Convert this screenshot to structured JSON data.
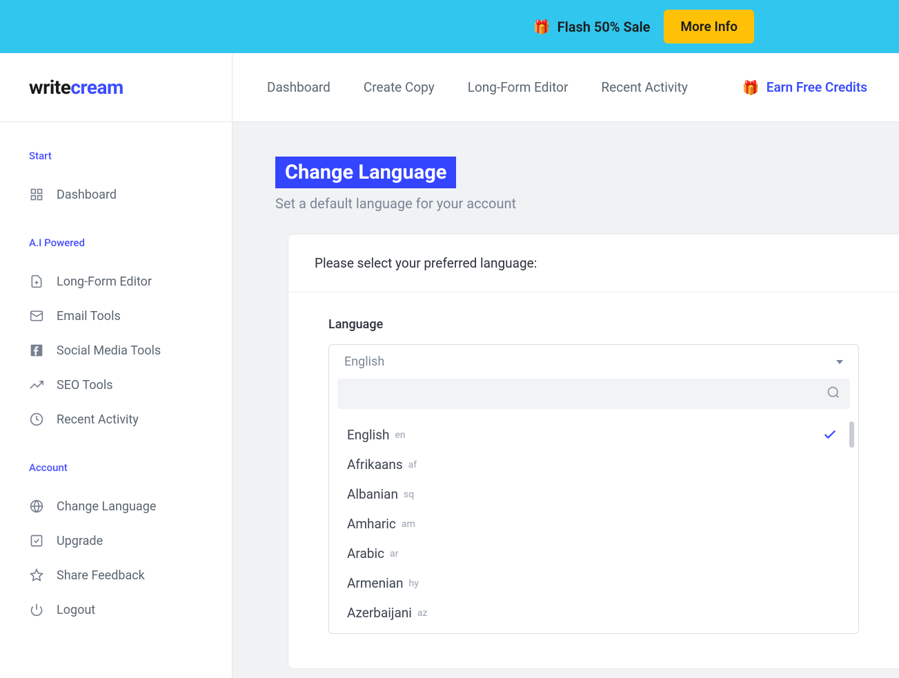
{
  "promo": {
    "text": "Flash 50% Sale",
    "button": "More Info"
  },
  "logo": {
    "part1": "write",
    "part2": "cream"
  },
  "nav": {
    "dashboard": "Dashboard",
    "create_copy": "Create Copy",
    "long_form": "Long-Form Editor",
    "recent": "Recent Activity",
    "credits": "Earn Free Credits"
  },
  "sidebar": {
    "sections": {
      "start": "Start",
      "ai": "A.I Powered",
      "account": "Account"
    },
    "items": {
      "dashboard": "Dashboard",
      "long_form": "Long-Form Editor",
      "email": "Email Tools",
      "social": "Social Media Tools",
      "seo": "SEO Tools",
      "recent": "Recent Activity",
      "change_lang": "Change Language",
      "upgrade": "Upgrade",
      "share": "Share Feedback",
      "logout": "Logout"
    }
  },
  "page": {
    "title": "Change Language",
    "subtitle": "Set a default language for your account",
    "card_head": "Please select your preferred language:",
    "field_label": "Language",
    "selected": "English"
  },
  "languages": [
    {
      "name": "English",
      "code": "en",
      "selected": true
    },
    {
      "name": "Afrikaans",
      "code": "af"
    },
    {
      "name": "Albanian",
      "code": "sq"
    },
    {
      "name": "Amharic",
      "code": "am"
    },
    {
      "name": "Arabic",
      "code": "ar"
    },
    {
      "name": "Armenian",
      "code": "hy"
    },
    {
      "name": "Azerbaijani",
      "code": "az"
    }
  ]
}
